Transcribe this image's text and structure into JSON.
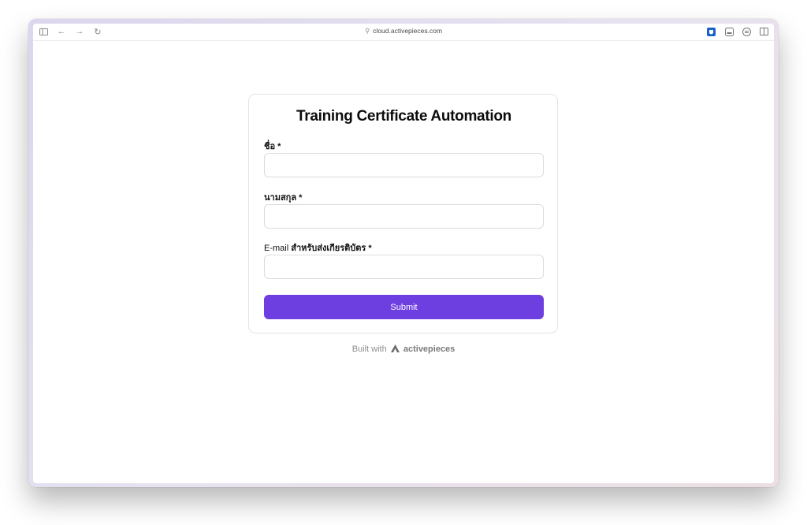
{
  "browser": {
    "url": "cloud.activepieces.com",
    "icons": [
      "sidebar-icon",
      "back-arrow-icon",
      "forward-arrow-icon",
      "reload-icon",
      "password-manager-icon",
      "tab-icon",
      "reader-icon",
      "split-view-icon"
    ]
  },
  "form": {
    "title": "Training Certificate Automation",
    "fields": [
      {
        "label": "ชื่อ *",
        "value": "",
        "placeholder": ""
      },
      {
        "label": "นามสกุล *",
        "value": "",
        "placeholder": ""
      },
      {
        "label_prefix": "E-mail",
        "label": "สำหรับส่งเกียรติบัตร *",
        "value": "",
        "placeholder": ""
      }
    ],
    "submit_label": "Submit"
  },
  "footer": {
    "built_with": "Built with",
    "brand": "activepieces"
  },
  "colors": {
    "accent": "#6e3fe0"
  }
}
